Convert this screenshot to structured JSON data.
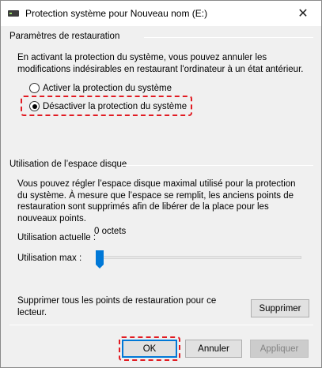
{
  "window": {
    "title": "Protection système pour Nouveau nom (E:)",
    "close_glyph": "✕"
  },
  "restore": {
    "heading": "Paramètres de restauration",
    "description": "En activant la protection du système, vous pouvez annuler les modifications indésirables en restaurant l'ordinateur à un état antérieur.",
    "options": [
      {
        "label": "Activer la protection du système",
        "checked": false
      },
      {
        "label": "Désactiver la protection du système",
        "checked": true
      }
    ]
  },
  "disk": {
    "heading": "Utilisation de l’espace disque",
    "description": "Vous pouvez régler l’espace disque maximal utilisé pour la protection du système. À mesure que l’espace se remplit, les anciens points de restauration sont supprimés afin de libérer de la place pour les nouveaux points.",
    "current_label": "Utilisation actuelle :",
    "current_value": "0 octets",
    "max_label": "Utilisation max :",
    "max_level_percent": 0
  },
  "delete": {
    "text": "Supprimer tous les points de restauration pour ce lecteur.",
    "button": "Supprimer"
  },
  "footer": {
    "ok": "OK",
    "cancel": "Annuler",
    "apply": "Appliquer"
  },
  "colors": {
    "highlight": "#e11b22",
    "accent": "#0078d7"
  },
  "icons": {
    "title": "drive-icon",
    "close": "close-icon"
  }
}
